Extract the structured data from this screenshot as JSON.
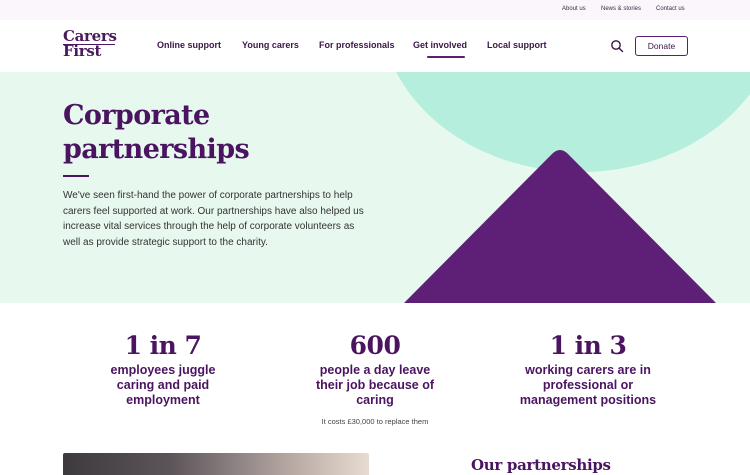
{
  "utility_nav": {
    "about": "About us",
    "news": "News & stories",
    "contact": "Contact us"
  },
  "brand": {
    "logo_line1": "Carers",
    "logo_line2": "First"
  },
  "main_nav": {
    "items": [
      {
        "label": "Online support"
      },
      {
        "label": "Young carers"
      },
      {
        "label": "For professionals"
      },
      {
        "label": "Get involved",
        "active": true
      },
      {
        "label": "Local support"
      }
    ],
    "search_icon": "search-icon",
    "donate_label": "Donate"
  },
  "hero": {
    "title": "Corporate partnerships",
    "body": "We've seen first-hand the power of corporate partnerships to help carers feel supported at work. Our partnerships have also helped us increase vital services through the help of corporate volunteers as well as provide strategic support to the charity."
  },
  "stats": [
    {
      "value": "1 in 7",
      "label": "employees juggle caring and paid employment"
    },
    {
      "value": "600",
      "label": "people a day leave their job because of caring",
      "note": "It costs £30,000 to replace them"
    },
    {
      "value": "1 in 3",
      "label": "working carers are in professional or management positions"
    }
  ],
  "partnerships": {
    "heading": "Our partnerships"
  },
  "colors": {
    "brand_purple": "#4a1461",
    "hero_bg": "#e7f8ef",
    "mint": "#b5eedd",
    "triangle": "#5e1f77"
  }
}
